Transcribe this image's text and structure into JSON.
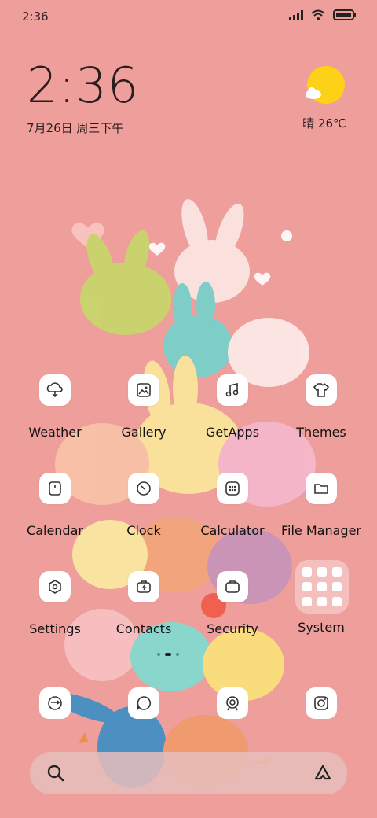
{
  "status_bar": {
    "time": "2:36",
    "icons": [
      "signal-icon",
      "wifi-icon",
      "battery-icon"
    ]
  },
  "clock_widget": {
    "time": "2:36",
    "date": "7月26日 周三下午"
  },
  "weather_widget": {
    "icon": "sun-cloud-icon",
    "condition_temp": "晴 26℃"
  },
  "apps": [
    {
      "label": "Weather",
      "icon": "weather-icon"
    },
    {
      "label": "Gallery",
      "icon": "gallery-icon"
    },
    {
      "label": "GetApps",
      "icon": "music-note-icon"
    },
    {
      "label": "Themes",
      "icon": "shirt-icon"
    },
    {
      "label": "Calendar",
      "icon": "calendar-icon"
    },
    {
      "label": "Clock",
      "icon": "clock-icon"
    },
    {
      "label": "Calculator",
      "icon": "calculator-icon"
    },
    {
      "label": "File Manager",
      "icon": "folder-icon"
    },
    {
      "label": "Settings",
      "icon": "gear-icon"
    },
    {
      "label": "Contacts",
      "icon": "contacts-icon"
    },
    {
      "label": "Security",
      "icon": "security-icon"
    }
  ],
  "folder": {
    "label": "System",
    "icon": "folder-grid-icon"
  },
  "dock": [
    {
      "icon": "phone-icon"
    },
    {
      "icon": "message-icon"
    },
    {
      "icon": "browser-icon"
    },
    {
      "icon": "camera-icon"
    }
  ],
  "search_bar": {
    "left_icon": "search-icon",
    "right_icon": "assistant-icon"
  },
  "colors": {
    "wallpaper": "#ef9f9b",
    "icon_background": "#ffffff",
    "sun": "#fcd118"
  }
}
